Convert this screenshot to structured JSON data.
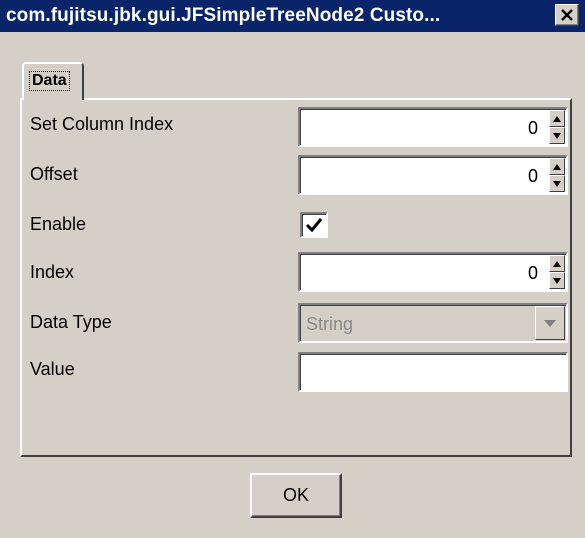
{
  "window": {
    "title": "com.fujitsu.jbk.gui.JFSimpleTreeNode2 Custo..."
  },
  "tabs": [
    {
      "label": "Data",
      "selected": true
    }
  ],
  "fields": {
    "set_column_index": {
      "label": "Set Column Index",
      "value": "0"
    },
    "offset": {
      "label": "Offset",
      "value": "0"
    },
    "enable": {
      "label": "Enable",
      "checked": true
    },
    "index": {
      "label": "Index",
      "value": "0"
    },
    "data_type": {
      "label": "Data Type",
      "value": "String",
      "enabled": false
    },
    "value": {
      "label": "Value",
      "value": ""
    }
  },
  "buttons": {
    "ok": "OK"
  },
  "icons": {
    "close": "close-icon",
    "spin_up": "up-arrow-icon",
    "spin_down": "down-arrow-icon",
    "dropdown": "chevron-down-icon",
    "check": "checkmark-icon"
  },
  "colors": {
    "titlebar": "#0a246a",
    "face": "#d4d0c8",
    "field": "#ffffff"
  }
}
